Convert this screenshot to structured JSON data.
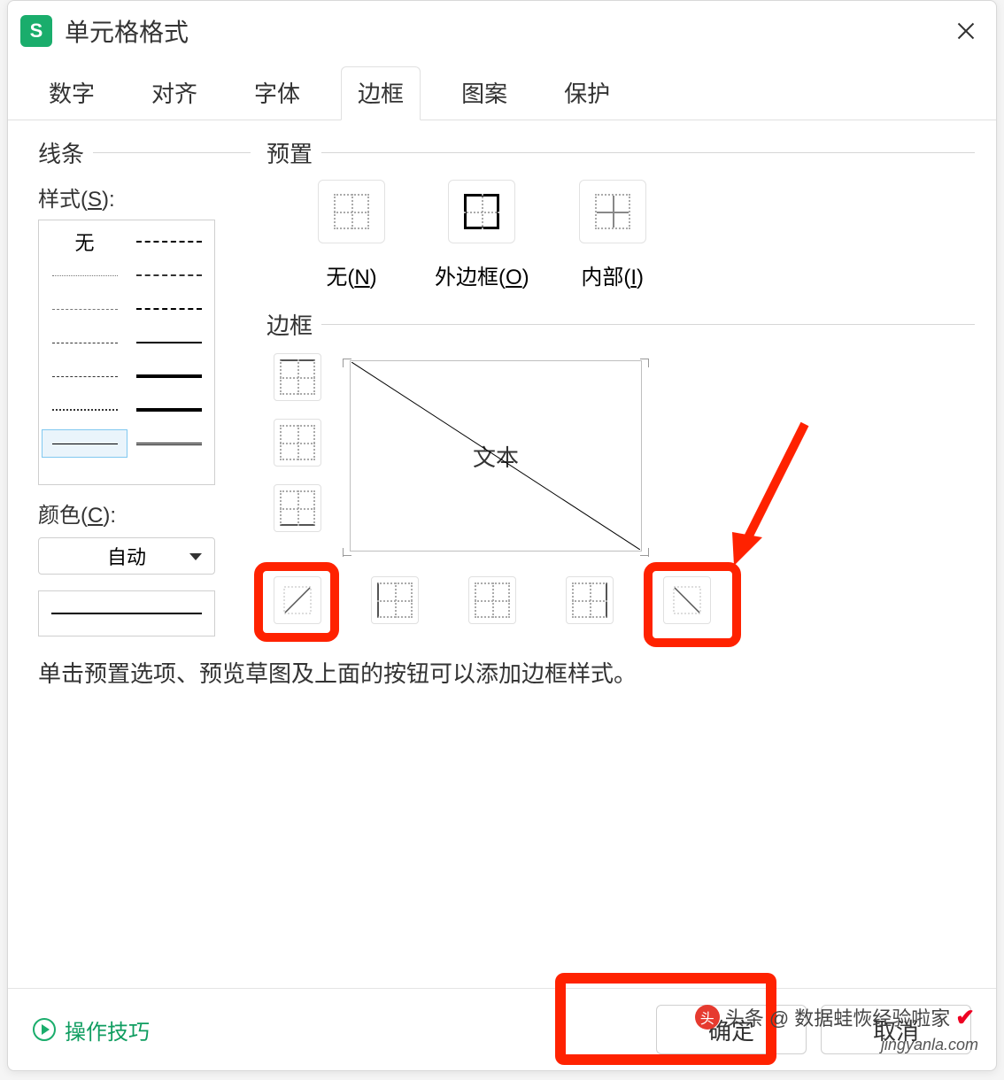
{
  "titlebar": {
    "app_letter": "S",
    "title": "单元格格式"
  },
  "tabs": [
    "数字",
    "对齐",
    "字体",
    "边框",
    "图案",
    "保护"
  ],
  "active_tab_index": 3,
  "left": {
    "group_label": "线条",
    "style_label_prefix": "样式(",
    "style_label_hotkey": "S",
    "style_label_suffix": "):",
    "none_text": "无",
    "color_label_prefix": "颜色(",
    "color_label_hotkey": "C",
    "color_label_suffix": "):",
    "color_value": "自动"
  },
  "right": {
    "preset_label": "预置",
    "presets": [
      {
        "label_prefix": "无(",
        "hotkey": "N",
        "label_suffix": ")"
      },
      {
        "label_prefix": "外边框(",
        "hotkey": "O",
        "label_suffix": ")"
      },
      {
        "label_prefix": "内部(",
        "hotkey": "I",
        "label_suffix": ")"
      }
    ],
    "border_label": "边框",
    "preview_text": "文本"
  },
  "hint": "单击预置选项、预览草图及上面的按钮可以添加边框样式。",
  "footer": {
    "tips": "操作技巧",
    "ok": "确定",
    "cancel": "取消"
  },
  "watermark": {
    "prefix": "头条 @",
    "name": "数据蛙恢经验啦家",
    "site": "jingyanla.com",
    "check": "✔"
  }
}
